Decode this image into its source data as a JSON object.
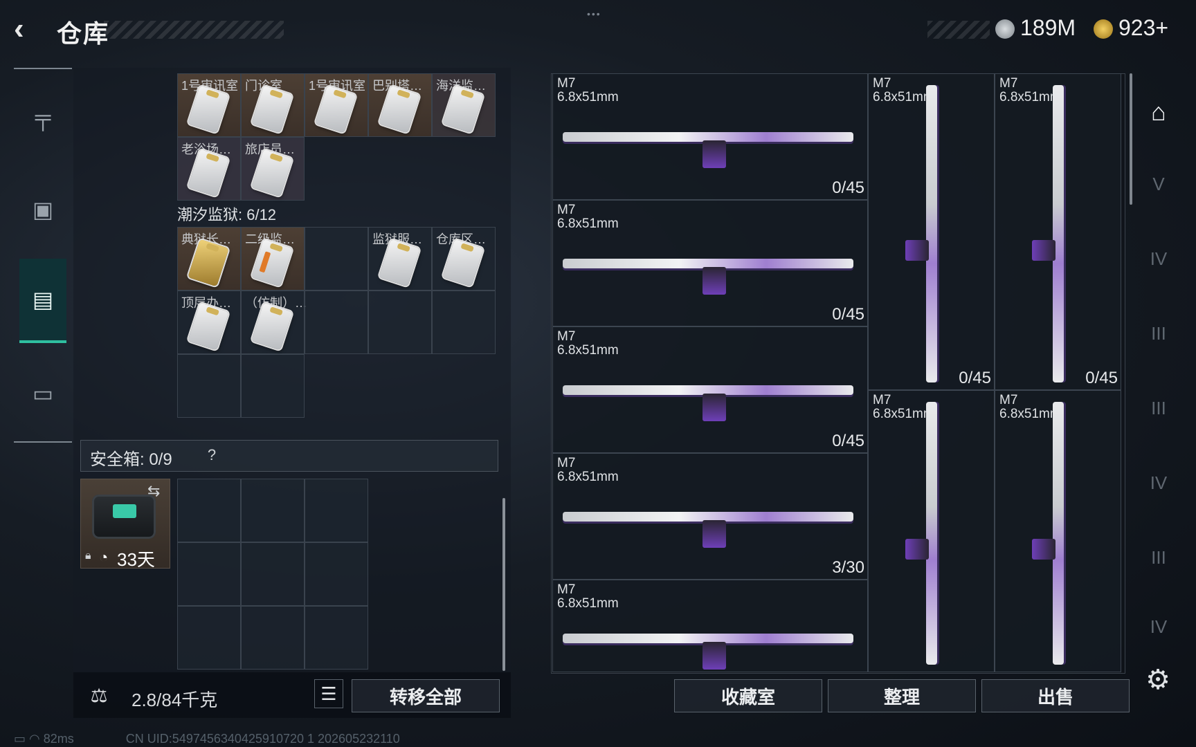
{
  "header": {
    "title": "仓库",
    "currency_silver": "189M",
    "currency_gold": "923+"
  },
  "left_nav": {
    "items": [
      {
        "name": "weapons",
        "icon": "gun-icon"
      },
      {
        "name": "backpack",
        "icon": "backpack-icon"
      },
      {
        "name": "vest",
        "icon": "vest-icon",
        "active": true
      },
      {
        "name": "case",
        "icon": "briefcase-icon"
      }
    ]
  },
  "keycards": {
    "group1": [
      "1号审讯室",
      "门诊室",
      "1号审讯室",
      "巴别塔…",
      "海洋监…",
      "老浴场…",
      "旅店员…"
    ],
    "zone_label": "潮汐监狱: 6/12",
    "group2": [
      "典狱长…",
      "二级监…",
      "",
      "监狱服…",
      "仓库区…",
      "顶层办…",
      "（仿制）…"
    ]
  },
  "safe_box": {
    "label": "安全箱: 0/9",
    "help": "?",
    "timer": "33天"
  },
  "bottom_left": {
    "weight": "2.8/84千克",
    "transfer_all": "转移全部"
  },
  "weapons": [
    {
      "name": "M7",
      "caliber": "6.8x51mm",
      "ammo": "0/45"
    },
    {
      "name": "M7",
      "caliber": "6.8x51mm",
      "ammo": "0/45"
    },
    {
      "name": "M7",
      "caliber": "6.8x51mm",
      "ammo": "0/45"
    },
    {
      "name": "M7",
      "caliber": "6.8x51mm",
      "ammo": "3/30"
    },
    {
      "name": "M7",
      "caliber": "6.8x51mm",
      "ammo": ""
    },
    {
      "name": "M7",
      "caliber": "6.8x51mm",
      "ammo": "0/45"
    },
    {
      "name": "M7",
      "caliber": "6.8x51mm",
      "ammo": "0/45"
    },
    {
      "name": "M7",
      "caliber": "6.8x51mm",
      "ammo": ""
    },
    {
      "name": "M7",
      "caliber": "6.8x51mm",
      "ammo": ""
    }
  ],
  "actions": {
    "collection": "收藏室",
    "sort": "整理",
    "sell": "出售"
  },
  "right_tabs": [
    "V",
    "IV",
    "III",
    "III",
    "IV",
    "III",
    "IV"
  ],
  "footer": {
    "ping": "82ms",
    "uid": "CN UID:5497456340425910720 1 202605232110"
  },
  "colors": {
    "accent_teal": "#2fbfa0",
    "weapon_purple": "#6e3fb8",
    "panel_dark": "#161c24"
  }
}
